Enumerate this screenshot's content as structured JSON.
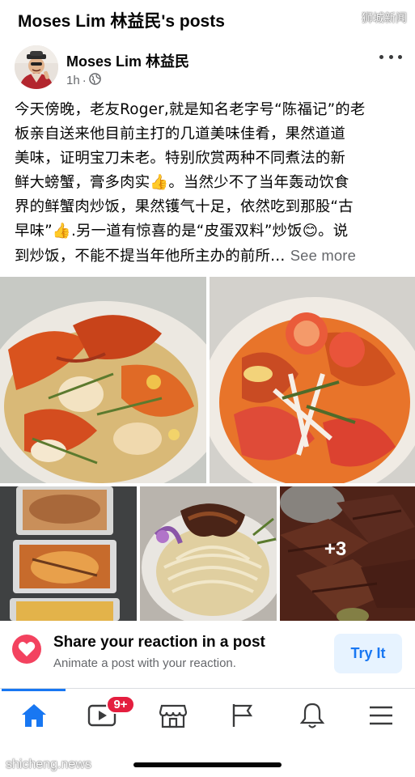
{
  "header": {
    "title": "Moses Lim 林益民's posts",
    "watermark_top": "狮城新闻"
  },
  "post": {
    "author": "Moses Lim 林益民",
    "time": "1h",
    "separator": "·",
    "privacy_icon": "globe-icon",
    "more_icon": "more-horizontal-icon",
    "text_lines": [
      "今天傍晚，老友Roger,就是知名老字号“陈福记”的老",
      "板亲自送来他目前主打的几道美味佳肴，果然道道",
      "美味，证明宝刀未老。特别欣赏两种不同煮法的新",
      "鲜大螃蟹，膏多肉实👍。当然少不了当年轰动饮食",
      "界的鲜蟹肉炒饭，果然镬气十足，依然吃到那股“古",
      "早味”👍.另一道有惊喜的是“皮蛋双料”炒饭😊。说",
      "到炒饭，不能不提当年他所主办的前所…"
    ],
    "see_more": "See more",
    "extra_photos": "+3"
  },
  "reaction": {
    "icon": "heart-icon",
    "title": "Share your reaction in a post",
    "subtitle": "Animate a post with your reaction.",
    "button": "Try It"
  },
  "nav": {
    "items": [
      "home-icon",
      "video-icon",
      "marketplace-icon",
      "pages-flag-icon",
      "notifications-bell-icon",
      "menu-icon"
    ],
    "video_badge": "9+"
  },
  "watermark_bottom": "shicheng.news",
  "colors": {
    "accent": "#1877f2",
    "badge": "#e41e3f",
    "reaction": "#f3425f",
    "secondary_text": "#65676b"
  }
}
